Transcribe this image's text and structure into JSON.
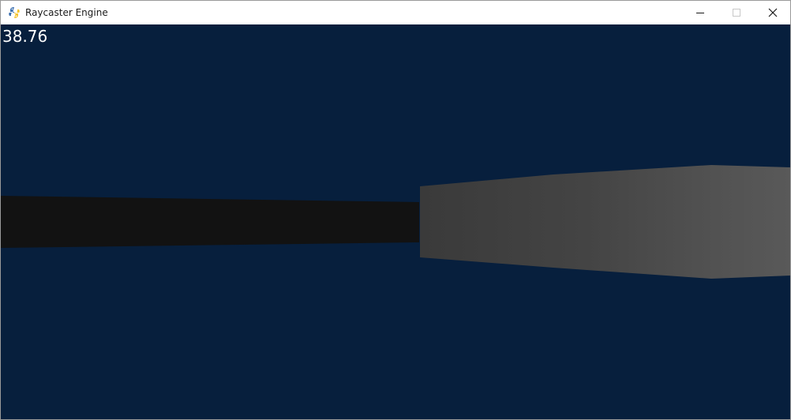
{
  "window": {
    "title": "Raycaster Engine",
    "icon": "pygame-snake-icon",
    "controls": [
      "minimize-icon",
      "maximize-icon",
      "close-icon"
    ]
  },
  "hud": {
    "fps": "38.76"
  },
  "colors": {
    "sky_floor": "#071f3d",
    "dark_wall": "#121212",
    "lit_wall_dark": "#393939",
    "lit_wall_light": "#575757",
    "hud_text": "#ffffff"
  }
}
